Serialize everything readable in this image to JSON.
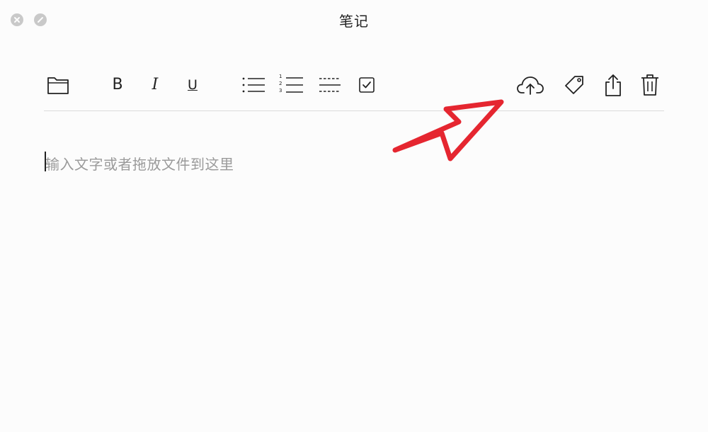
{
  "window": {
    "title": "笔记"
  },
  "titlebar": {
    "controls": [
      {
        "name": "close",
        "icon": "close-icon"
      },
      {
        "name": "minimize",
        "icon": "minimize-icon"
      }
    ]
  },
  "toolbar": {
    "left": [
      {
        "name": "folder",
        "icon": "folder-icon"
      },
      {
        "name": "bold",
        "label": "B"
      },
      {
        "name": "italic",
        "label": "I"
      },
      {
        "name": "underline",
        "label": "U"
      },
      {
        "name": "bullet-list",
        "icon": "bullet-list-icon"
      },
      {
        "name": "numbered-list",
        "icon": "numbered-list-icon"
      },
      {
        "name": "divider",
        "icon": "dashed-lines-icon"
      },
      {
        "name": "checkbox",
        "icon": "checkbox-icon"
      }
    ],
    "right": [
      {
        "name": "upload",
        "icon": "cloud-upload-icon"
      },
      {
        "name": "tag",
        "icon": "tag-icon"
      },
      {
        "name": "share",
        "icon": "share-icon"
      },
      {
        "name": "delete",
        "icon": "trash-icon"
      }
    ],
    "bold_label": "B",
    "italic_label": "I",
    "underline_label": "U",
    "numbered_list_digits": [
      "1",
      "2",
      "3"
    ]
  },
  "editor": {
    "placeholder": "输入文字或者拖放文件到这里"
  },
  "colors": {
    "background": "#fcfcfc",
    "icon": "#222222",
    "placeholder": "#9a9a9a",
    "annotation_arrow": "#e52630",
    "traffic_light": "#c9c9c9"
  }
}
